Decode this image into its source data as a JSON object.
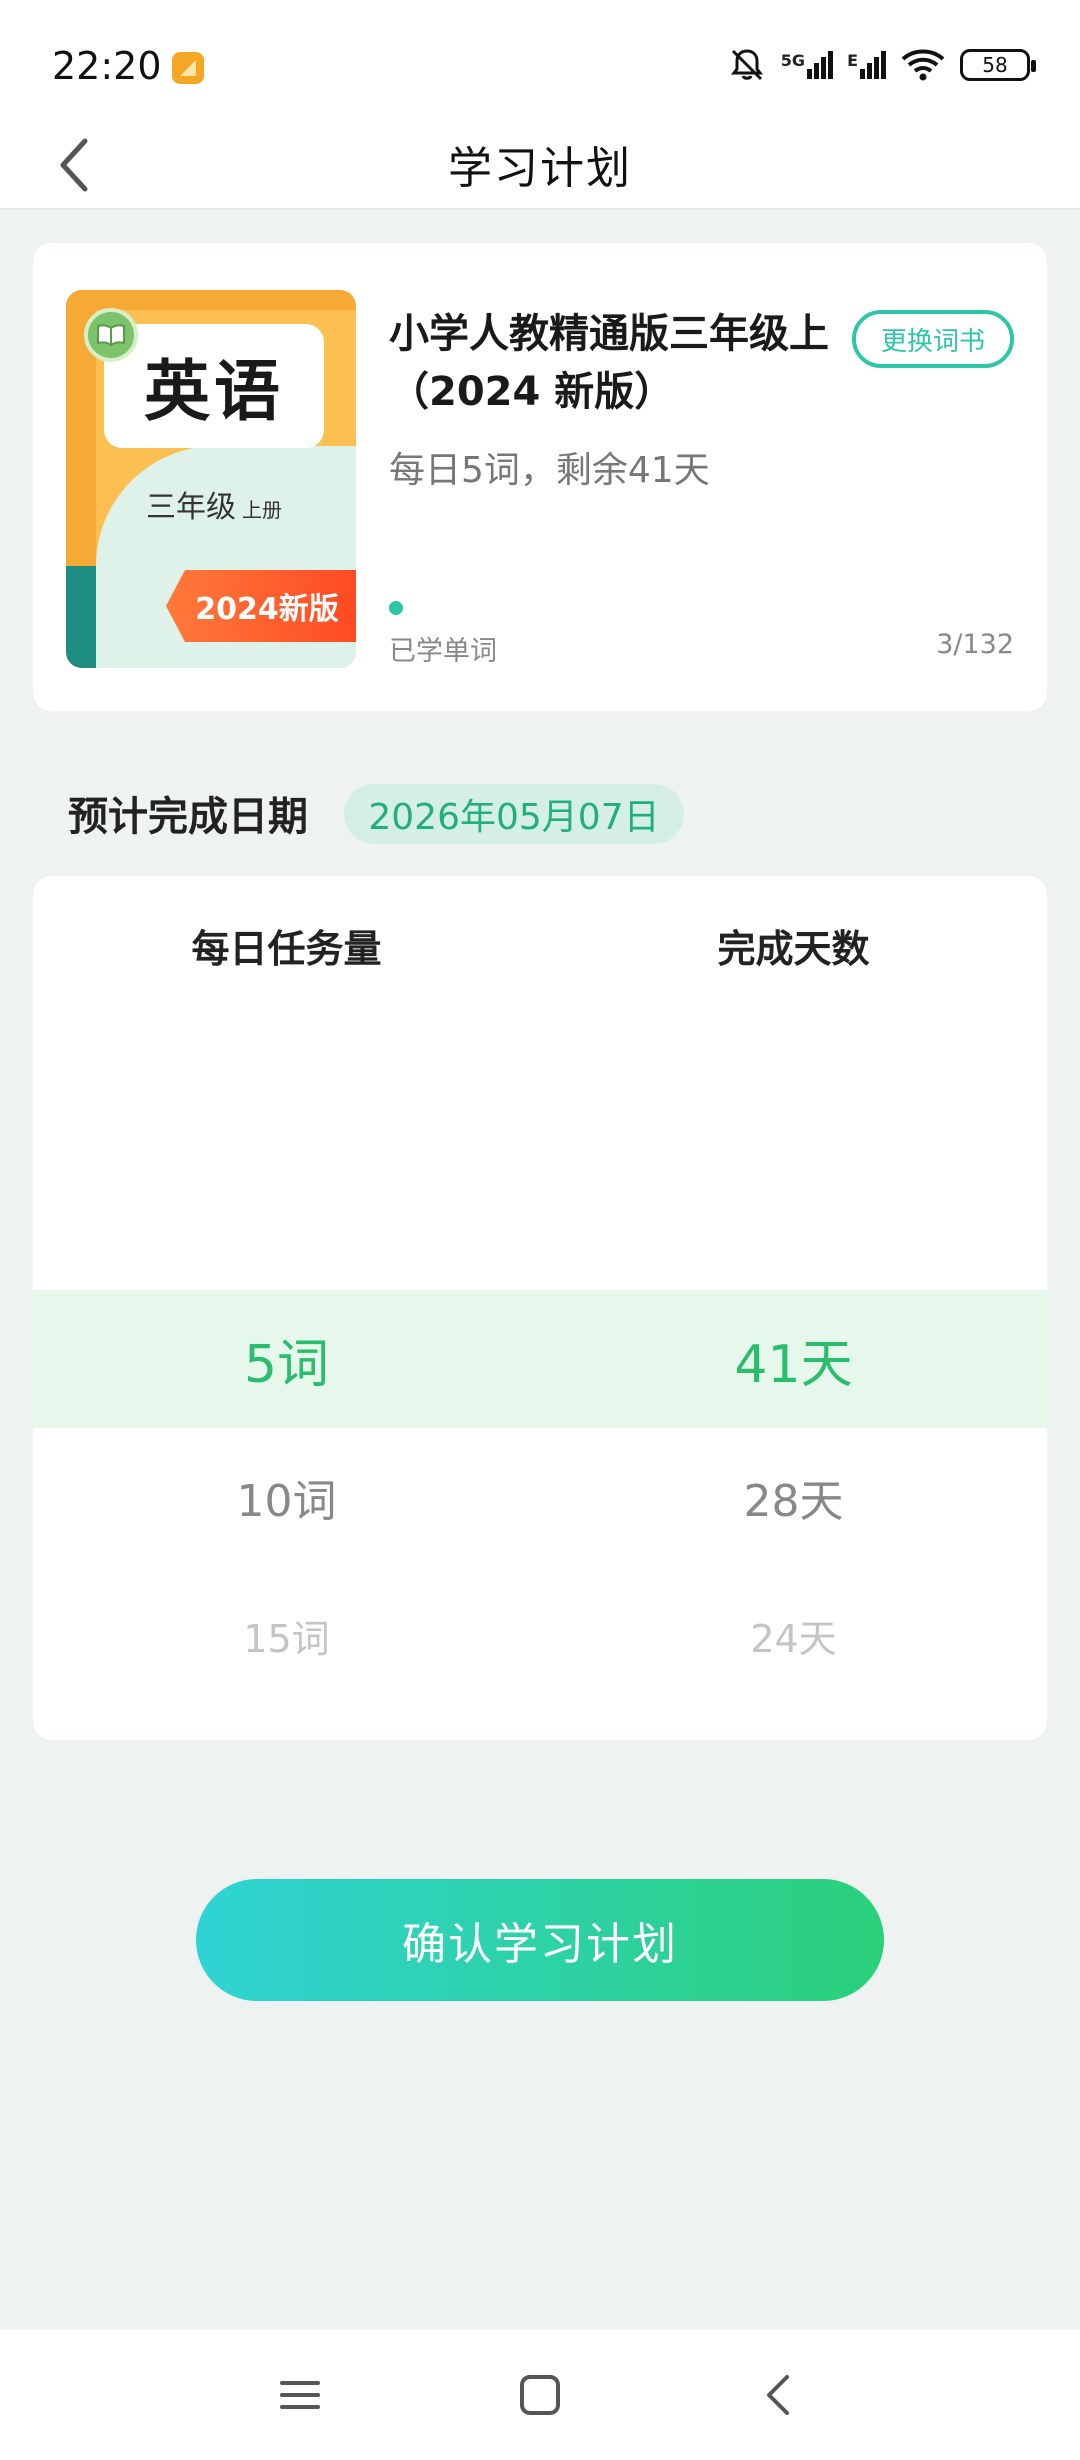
{
  "status_bar": {
    "time": "22:20",
    "network": "5G",
    "network2": "E",
    "battery": "58"
  },
  "header": {
    "title": "学习计划"
  },
  "book": {
    "cover_title": "英语",
    "cover_grade": "三年级",
    "cover_volume": "上册",
    "cover_edition": "2024新版",
    "title": "小学人教精通版三年级上（2024 新版）",
    "change_label": "更换词书",
    "subtitle": "每日5词，剩余41天",
    "learned_label": "已学单词",
    "learned_count": "3/132",
    "progress": 0.0227
  },
  "completion": {
    "label": "预计完成日期",
    "date": "2026年05月07日"
  },
  "picker": {
    "col_daily": "每日任务量",
    "col_days": "完成天数",
    "rows": [
      {
        "daily": "5词",
        "days": "41天"
      },
      {
        "daily": "10词",
        "days": "28天"
      },
      {
        "daily": "15词",
        "days": "24天"
      }
    ]
  },
  "confirm_label": "确认学习计划",
  "colors": {
    "accent": "#2ec6a8",
    "selected_text": "#2abd6b",
    "highlight": "#e6f8ec",
    "edition_badge": "#ff5a2a"
  }
}
